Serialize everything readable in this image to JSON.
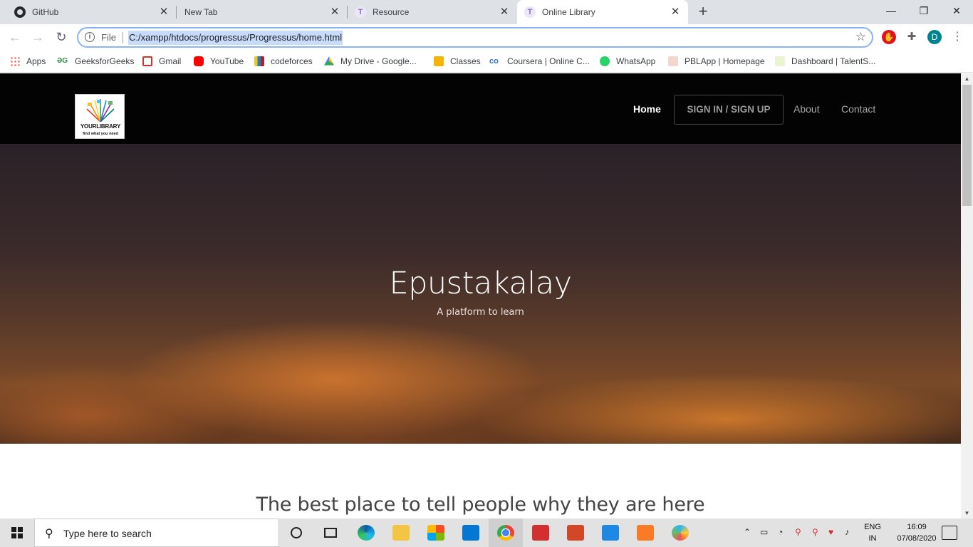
{
  "browser": {
    "tabs": [
      {
        "label": "GitHub",
        "icon": "github-icon"
      },
      {
        "label": "New Tab",
        "icon": "none"
      },
      {
        "label": "Resource",
        "icon": "t-icon"
      },
      {
        "label": "Online Library",
        "icon": "t-icon",
        "active": true
      }
    ],
    "new_tab_symbol": "+",
    "window_controls": {
      "minimize": "—",
      "maximize": "❐",
      "close": "✕"
    },
    "omnibox": {
      "info_symbol": "i",
      "scheme_label": "File",
      "url": "C:/xampp/htdocs/progressus/Progressus/home.html",
      "star_symbol": "☆"
    },
    "profile_initial": "D",
    "menu_symbol": "⋮"
  },
  "bookmarks": [
    {
      "label": "Apps",
      "icon": "apps-icon"
    },
    {
      "label": "GeeksforGeeks",
      "icon": "gfg-icon"
    },
    {
      "label": "Gmail",
      "icon": "gmail-icon"
    },
    {
      "label": "YouTube",
      "icon": "youtube-icon"
    },
    {
      "label": "codeforces",
      "icon": "codeforces-icon"
    },
    {
      "label": "My Drive - Google...",
      "icon": "drive-icon"
    },
    {
      "label": "Classes",
      "icon": "classroom-icon"
    },
    {
      "label": "Coursera | Online C...",
      "icon": "coursera-icon"
    },
    {
      "label": "WhatsApp",
      "icon": "whatsapp-icon"
    },
    {
      "label": "PBLApp | Homepage",
      "icon": "pbl-icon"
    },
    {
      "label": "Dashboard | TalentS...",
      "icon": "talent-icon"
    }
  ],
  "site": {
    "logo": {
      "line1": "YOURLIBRARY",
      "line2": "find what you need"
    },
    "nav": {
      "home": "Home",
      "signin": "SIGN IN / SIGN UP",
      "about": "About",
      "contact": "Contact"
    },
    "hero": {
      "title": "Epustakalay",
      "subtitle": "A platform to learn"
    },
    "lead": "The best place to tell people why they are here"
  },
  "taskbar": {
    "search_placeholder": "Type here to search",
    "language": {
      "line1": "ENG",
      "line2": "IN"
    },
    "clock": {
      "time": "16:09",
      "date": "07/08/2020"
    },
    "apps": [
      "cortana-icon",
      "task-view-icon",
      "edge-icon",
      "file-explorer-icon",
      "store-icon",
      "mail-icon",
      "chrome-icon",
      "reader-icon",
      "powerpoint-icon",
      "wps-icon",
      "xampp-icon",
      "paint-icon"
    ]
  },
  "colors": {
    "tabstrip": "#dee1e6",
    "site_nav_bg": "#030303",
    "hero_orange": "#ce742e",
    "omnibox_focus": "#8ab4f8",
    "profile_avatar": "#00838f"
  }
}
